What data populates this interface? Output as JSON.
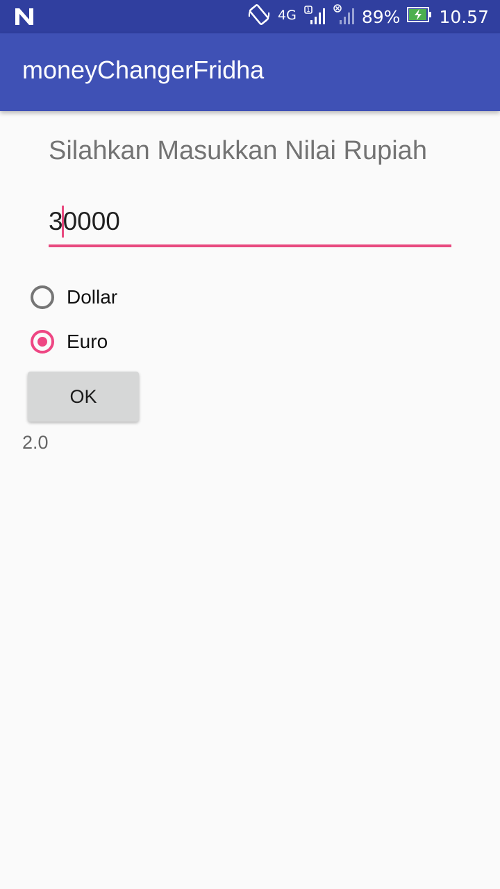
{
  "status_bar": {
    "network_type": "4G",
    "sim_slot": "1",
    "battery_percent": "89%",
    "time": "10.57",
    "icons": [
      "n-logo-icon",
      "rotate-icon",
      "signal-icon",
      "no-sim-icon",
      "battery-charging-icon"
    ]
  },
  "app_bar": {
    "title": "moneyChangerFridha"
  },
  "form": {
    "prompt": "Silahkan Masukkan Nilai Rupiah",
    "amount_value": "30000",
    "currency_options": [
      {
        "label": "Dollar",
        "checked": false
      },
      {
        "label": "Euro",
        "checked": true
      }
    ],
    "ok_label": "OK",
    "result": "2.0"
  },
  "colors": {
    "status_bar": "#303f9f",
    "app_bar": "#3f51b5",
    "accent": "#e84a7f",
    "background": "#fafafa",
    "button": "#d6d7d7"
  }
}
